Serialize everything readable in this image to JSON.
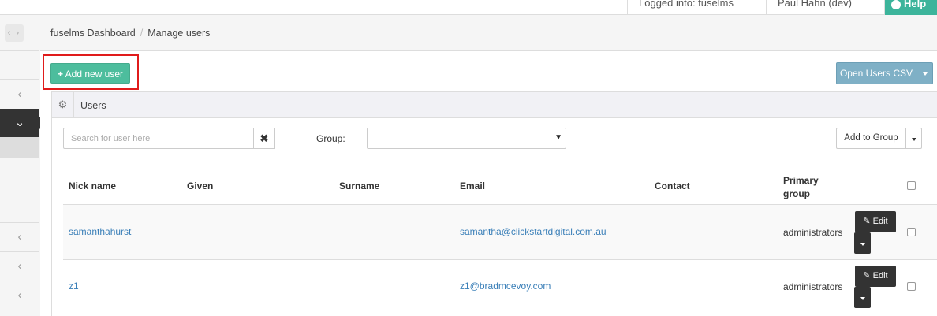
{
  "header": {
    "logged_in": "Logged into: fuselms",
    "user": "Paul Hahn (dev)",
    "help": "Help"
  },
  "breadcrumb": {
    "home": "fuselms Dashboard",
    "separator": "/",
    "current": "Manage users"
  },
  "toolbar": {
    "add_user_label": "Add new user",
    "add_user_icon": "+",
    "open_csv_label": "Open Users CSV"
  },
  "panel": {
    "title": "Users",
    "gear_icon": "⚙"
  },
  "filters": {
    "search_placeholder": "Search for user here",
    "search_value": "",
    "clear_icon": "✖",
    "group_label": "Group:",
    "group_value": "",
    "group_caret": "▼",
    "add_to_group_label": "Add to Group"
  },
  "table": {
    "columns": {
      "nick": "Nick name",
      "given": "Given",
      "surname": "Surname",
      "email": "Email",
      "contact": "Contact",
      "primary_group_line1": "Primary",
      "primary_group_line2": "group"
    },
    "rows": [
      {
        "nick": "samanthahurst",
        "given": "",
        "surname": "",
        "email": "samantha@clickstartdigital.com.au",
        "contact": "",
        "primary_group": "administrators",
        "edit_label": "Edit"
      },
      {
        "nick": "z1",
        "given": "",
        "surname": "",
        "email": "z1@bradmcevoy.com",
        "contact": "",
        "primary_group": "administrators",
        "edit_label": "Edit"
      }
    ]
  },
  "sidebar": {
    "nav_arrows": "‹ ›",
    "items": [
      "‹",
      "⌄",
      "‹",
      "‹",
      "‹"
    ]
  },
  "colors": {
    "accent_green": "#4dbd9d",
    "csv_blue": "#7fb0c6",
    "highlight_red": "#e01b1b",
    "link_blue": "#3a7fb8"
  }
}
